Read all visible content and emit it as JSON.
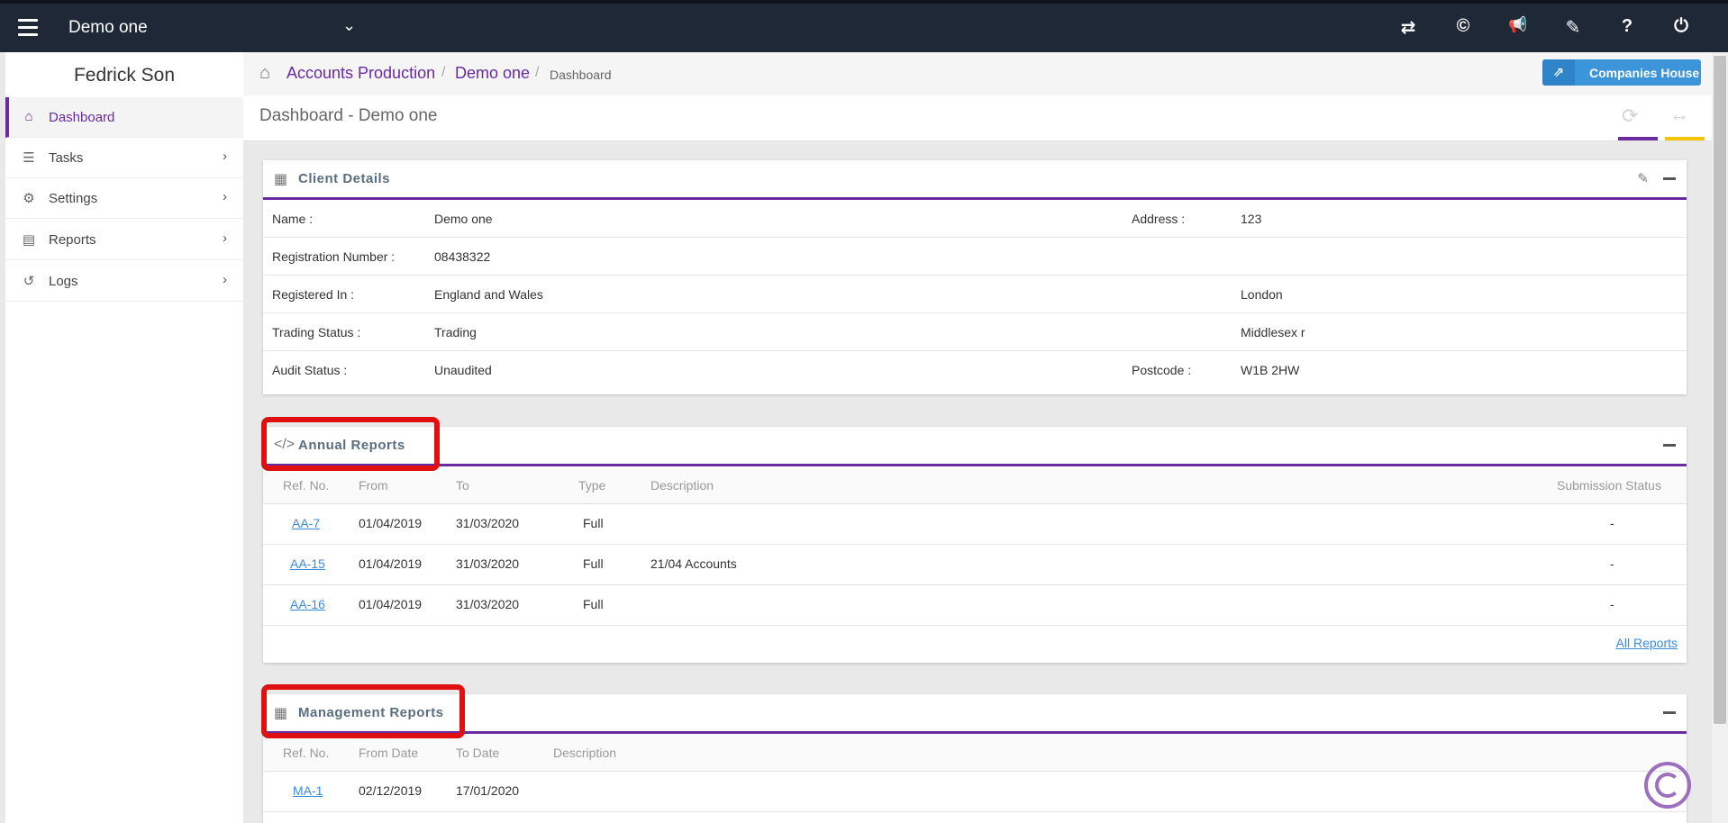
{
  "topbar": {
    "client_name": "Demo one",
    "icons": [
      "menu-icon",
      "chevron-down-icon",
      "switch-icon",
      "copyright-icon",
      "megaphone-icon",
      "ticket-icon",
      "help-icon",
      "power-icon"
    ],
    "glyphs": {
      "switch": "⇄",
      "copyright": "©",
      "megaphone": "📢",
      "ticket": "✎",
      "help": "?",
      "power": "⏻",
      "chevron": "⌄"
    }
  },
  "sidebar": {
    "user_name": "Fedrick Son",
    "items": [
      {
        "label": "Dashboard",
        "icon": "home-icon",
        "glyph": "⌂",
        "active": true
      },
      {
        "label": "Tasks",
        "icon": "tasks-icon",
        "glyph": "☰",
        "arrow": "›"
      },
      {
        "label": "Settings",
        "icon": "gear-icon",
        "glyph": "⚙",
        "arrow": "›"
      },
      {
        "label": "Reports",
        "icon": "file-icon",
        "glyph": "▤",
        "arrow": "›"
      },
      {
        "label": "Logs",
        "icon": "history-icon",
        "glyph": "↺",
        "arrow": "›"
      }
    ]
  },
  "breadcrumb": {
    "home_glyph": "⌂",
    "items": [
      "Accounts Production",
      "Demo one"
    ],
    "current": "Dashboard",
    "separator": "/"
  },
  "companies_house": {
    "label": "Companies House",
    "glyph": "⇗"
  },
  "page": {
    "title": "Dashboard - Demo one",
    "refresh_glyph": "⟳",
    "expand_glyph": "↔"
  },
  "client_details": {
    "title": "Client Details",
    "rows": [
      {
        "label": "Name :",
        "value": "Demo one",
        "label2": "Address :",
        "value2": "123"
      },
      {
        "label": "Registration Number :",
        "value": "08438322",
        "label2": "",
        "value2": ""
      },
      {
        "label": "Registered In :",
        "value": "England and Wales",
        "label2": "",
        "value2": "London"
      },
      {
        "label": "Trading Status :",
        "value": "Trading",
        "label2": "",
        "value2": "Middlesex r"
      },
      {
        "label": "Audit Status :",
        "value": "Unaudited",
        "label2": "Postcode :",
        "value2": "W1B 2HW"
      }
    ]
  },
  "annual_reports": {
    "title": "Annual Reports",
    "columns": [
      "Ref. No.",
      "From",
      "To",
      "Type",
      "Description",
      "Submission Status"
    ],
    "rows": [
      {
        "ref": "AA-7",
        "from": "01/04/2019",
        "to": "31/03/2020",
        "type": "Full",
        "description": "",
        "status": "-"
      },
      {
        "ref": "AA-15",
        "from": "01/04/2019",
        "to": "31/03/2020",
        "type": "Full",
        "description": "21/04 Accounts",
        "status": "-"
      },
      {
        "ref": "AA-16",
        "from": "01/04/2019",
        "to": "31/03/2020",
        "type": "Full",
        "description": "",
        "status": "-"
      }
    ],
    "all_link": "All Reports"
  },
  "management_reports": {
    "title": "Management Reports",
    "columns": [
      "Ref. No.",
      "From Date",
      "To Date",
      "Description"
    ],
    "rows": [
      {
        "ref": "MA-1",
        "from": "02/12/2019",
        "to": "17/01/2020",
        "description": ""
      }
    ]
  },
  "colors": {
    "accent": "#6a2aa0",
    "topbar": "#1f2837",
    "link": "#3c8ad8",
    "highlight": "#e01010",
    "button": "#3c94d9"
  }
}
